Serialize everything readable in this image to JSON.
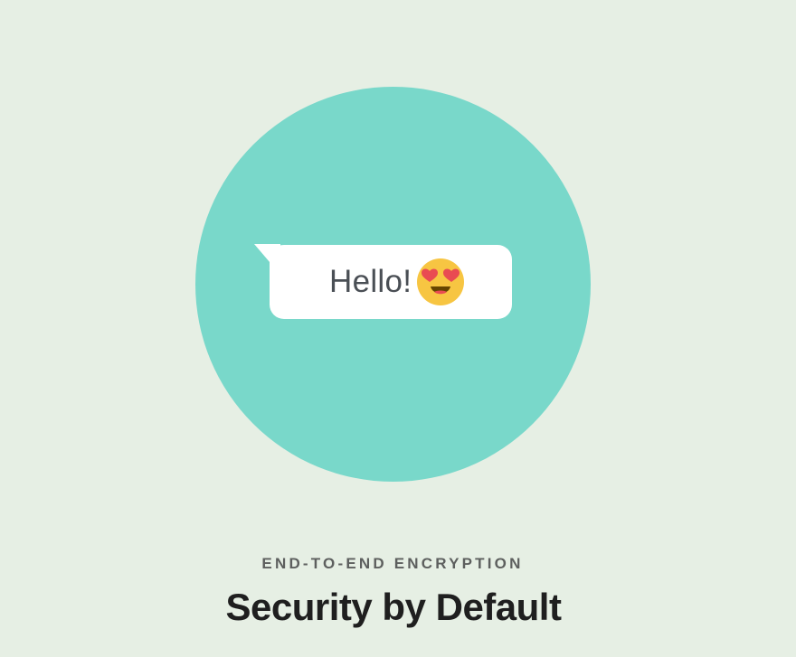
{
  "illustration": {
    "message_text": "Hello!",
    "emoji_icon": "smiling-face-with-heart-eyes-icon",
    "circle_color": "#79d8ca",
    "bubble_color": "#ffffff",
    "emoji_color": "#f7c542",
    "heart_color": "#e94b52"
  },
  "section": {
    "eyebrow": "END-TO-END ENCRYPTION",
    "headline": "Security by Default"
  },
  "colors": {
    "background": "#e6efe4",
    "eyebrow_text": "#5d5f5e",
    "headline_text": "#1f1f1f"
  }
}
